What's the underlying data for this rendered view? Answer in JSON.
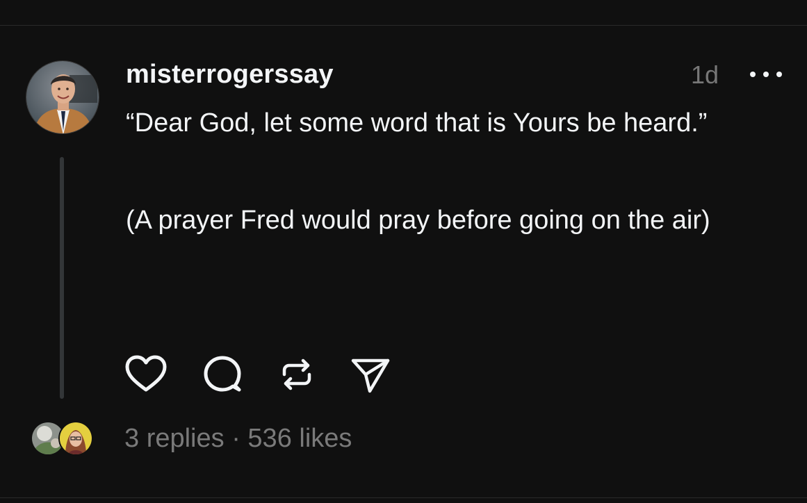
{
  "post": {
    "username": "misterrogerssay",
    "timestamp": "1d",
    "text_lines": [
      "“Dear God, let some word that is Yours be heard.”",
      "(A prayer Fred would pray before going on the air)"
    ],
    "stats": {
      "replies": "3 replies",
      "separator": "·",
      "likes": "536 likes"
    }
  },
  "icons": {
    "avatar": "profile-photo",
    "more": "more-dots-icon",
    "like": "heart-icon",
    "reply": "comment-bubble-icon",
    "repost": "repost-arrows-icon",
    "share": "send-paper-plane-icon"
  },
  "colors": {
    "background": "#101010",
    "text_primary": "#f3f5f7",
    "text_secondary": "#777777",
    "thread_line": "#333638",
    "divider": "#2a2a2a"
  }
}
